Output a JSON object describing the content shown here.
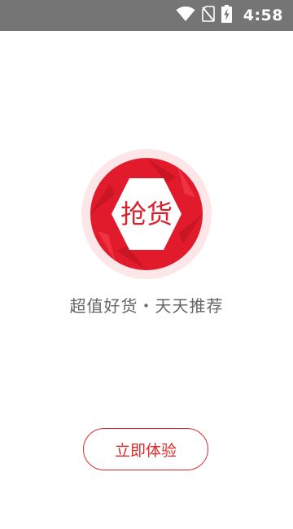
{
  "status_bar": {
    "time": "4:58",
    "icons": [
      "wifi-icon",
      "no-sim-icon",
      "battery-charging-icon"
    ]
  },
  "logo": {
    "text": "抢货",
    "colors": {
      "red": "#e21b2c",
      "dark_red": "#b5121f",
      "halo": "#fde6e8"
    }
  },
  "slogan": "超值好货・天天推荐",
  "cta_button": {
    "label": "立即体验",
    "color": "#e02a2a"
  }
}
